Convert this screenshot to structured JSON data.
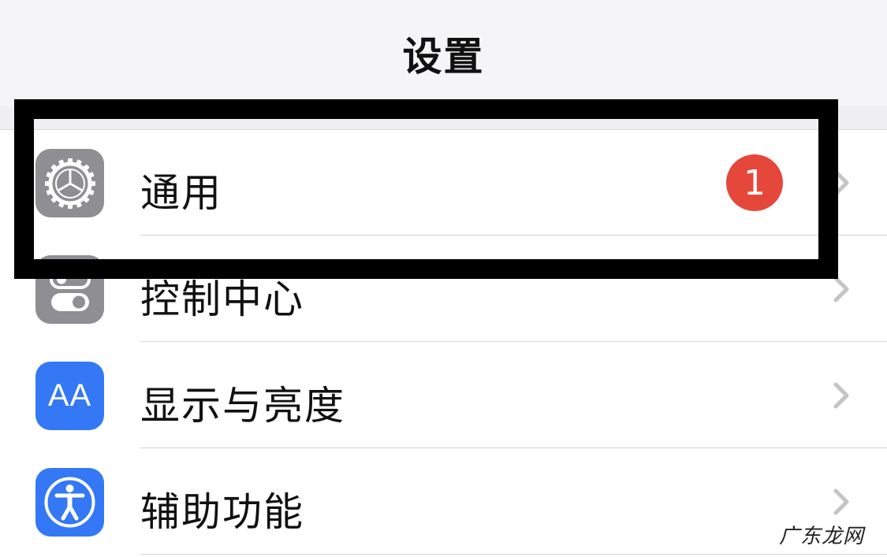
{
  "nav": {
    "title": "设置"
  },
  "settings_rows": [
    {
      "label": "通用",
      "icon": "gear-icon",
      "icon_bg": "#8e8e93",
      "badge": "1"
    },
    {
      "label": "控制中心",
      "icon": "toggle-switches-icon",
      "icon_bg": "#8e8e93"
    },
    {
      "label": "显示与亮度",
      "icon": "text-size-aa-icon",
      "icon_text": "AA",
      "icon_bg": "#3478f6"
    },
    {
      "label": "辅助功能",
      "icon": "accessibility-icon",
      "icon_bg": "#3478f6"
    }
  ],
  "colors": {
    "badge": "#e5473b",
    "annotation_frame": "#000000",
    "chevron": "#c4c4c7"
  },
  "watermark": "广东龙网"
}
